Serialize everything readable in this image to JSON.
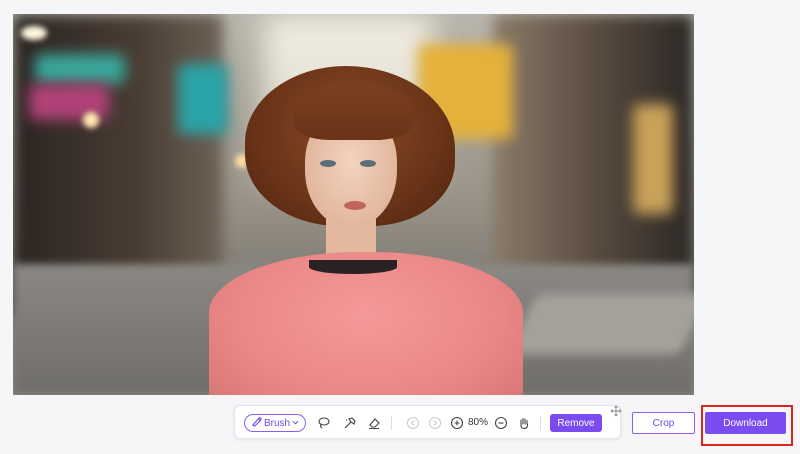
{
  "toolbar": {
    "brush_label": "Brush",
    "zoom_level": "80%",
    "remove_label": "Remove"
  },
  "actions": {
    "crop_label": "Crop",
    "download_label": "Download"
  },
  "colors": {
    "accent": "#7a4cf0",
    "highlight_frame": "#d9251e"
  },
  "icons": [
    "brush-icon",
    "chevron-down-icon",
    "lasso-icon",
    "magic-brush-icon",
    "eraser-icon",
    "undo-icon",
    "redo-icon",
    "zoom-in-icon",
    "zoom-out-icon",
    "hand-icon",
    "move-icon"
  ]
}
